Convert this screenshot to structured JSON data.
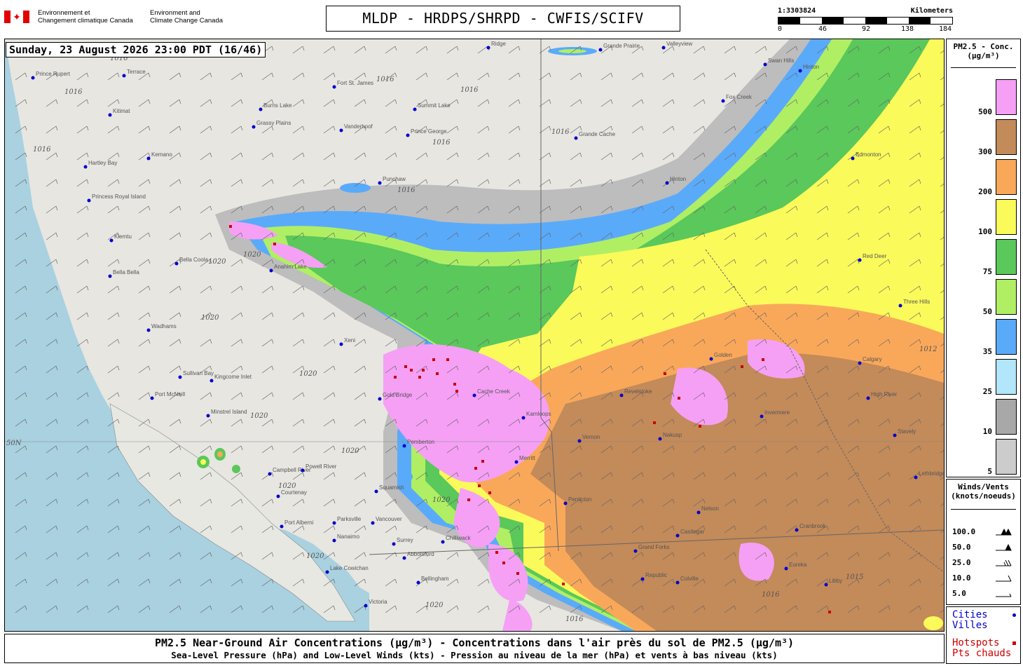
{
  "header": {
    "agency_fr": "Environnement et\nChangement climatique Canada",
    "agency_en": "Environment and\nClimate Change Canada",
    "title": "MLDP - HRDPS/SHRPD - CWFIS/SCIFV"
  },
  "scale": {
    "ratio": "1:3303824",
    "unit": "Kilometers",
    "ticks": [
      "0",
      "46",
      "92",
      "138",
      "184"
    ]
  },
  "map": {
    "timestamp": "Sunday, 23 August 2026 23:00 PDT (16/46)",
    "latitude_label": "50N",
    "cities": [
      {
        "name": "Ridge"
      },
      {
        "name": "Grande Prairie"
      },
      {
        "name": "Valleyview"
      },
      {
        "name": "Swan Hills"
      },
      {
        "name": "Prince Rupert"
      },
      {
        "name": "Terrace"
      },
      {
        "name": "Fort St. James"
      },
      {
        "name": "Burns Lake"
      },
      {
        "name": "Summit Lake"
      },
      {
        "name": "Fox Creek"
      },
      {
        "name": "Hinton"
      },
      {
        "name": "Grassy Plains"
      },
      {
        "name": "Vanderhoof"
      },
      {
        "name": "Prince George"
      },
      {
        "name": "Grande Cache"
      },
      {
        "name": "Edmonton"
      },
      {
        "name": "Kitimat"
      },
      {
        "name": "Hartley Bay"
      },
      {
        "name": "Kemano"
      },
      {
        "name": "Punchaw"
      },
      {
        "name": "Hinton"
      },
      {
        "name": "Princess Royal Island"
      },
      {
        "name": "Klemtu"
      },
      {
        "name": "Bella Bella"
      },
      {
        "name": "Bella Coola"
      },
      {
        "name": "Anahim Lake"
      },
      {
        "name": "Red Deer"
      },
      {
        "name": "Wadhams"
      },
      {
        "name": "Xeni"
      },
      {
        "name": "Three Hills"
      },
      {
        "name": "Sullivan Bay"
      },
      {
        "name": "Kingcome Inlet"
      },
      {
        "name": "Cache Creek"
      },
      {
        "name": "Golden"
      },
      {
        "name": "Calgary"
      },
      {
        "name": "Port McNeill"
      },
      {
        "name": "Gold Bridge"
      },
      {
        "name": "Revelstoke"
      },
      {
        "name": "High River"
      },
      {
        "name": "Minstrel Island"
      },
      {
        "name": "Kamloops"
      },
      {
        "name": "Nakusp"
      },
      {
        "name": "Stavely"
      },
      {
        "name": "Pemberton"
      },
      {
        "name": "Merritt"
      },
      {
        "name": "Vernon"
      },
      {
        "name": "Invermere"
      },
      {
        "name": "Campbell River"
      },
      {
        "name": "Powell River"
      },
      {
        "name": "Courtenay"
      },
      {
        "name": "Squamish"
      },
      {
        "name": "Penticton"
      },
      {
        "name": "Nelson"
      },
      {
        "name": "Port Alberni"
      },
      {
        "name": "Parksville"
      },
      {
        "name": "Vancouver"
      },
      {
        "name": "Nanaimo"
      },
      {
        "name": "Surrey"
      },
      {
        "name": "Chilliwack"
      },
      {
        "name": "Castlegar"
      },
      {
        "name": "Cranbrook"
      },
      {
        "name": "Lethbridge"
      },
      {
        "name": "Abbotsford"
      },
      {
        "name": "Grand Forks"
      },
      {
        "name": "Lake Cowichan"
      },
      {
        "name": "Bellingham"
      },
      {
        "name": "Victoria"
      },
      {
        "name": "Eureka"
      },
      {
        "name": "Libby"
      },
      {
        "name": "Colville"
      },
      {
        "name": "Republic"
      }
    ],
    "isobars": [
      "1016",
      "1016",
      "1016",
      "1016",
      "1016",
      "1016",
      "1016",
      "1016",
      "1016",
      "1016",
      "1020",
      "1020",
      "1020",
      "1020",
      "1020",
      "1020",
      "1020",
      "1020",
      "1020",
      "1020",
      "1012",
      "1015"
    ]
  },
  "legend_conc": {
    "title": "PM2.5 - Conc.\n(µg/m³)",
    "bins": [
      {
        "label": "500",
        "color": "#f5a0f5"
      },
      {
        "label": "300",
        "color": "#c38a5a"
      },
      {
        "label": "200",
        "color": "#f9a85a"
      },
      {
        "label": "100",
        "color": "#fafa5a"
      },
      {
        "label": "75",
        "color": "#5ac85a"
      },
      {
        "label": "50",
        "color": "#b0ef64"
      },
      {
        "label": "35",
        "color": "#5aaafa"
      },
      {
        "label": "25",
        "color": "#b2e6fa"
      },
      {
        "label": "10",
        "color": "#a8a8a8"
      },
      {
        "label": "5",
        "color": "#cccccc"
      }
    ]
  },
  "legend_wind": {
    "title": "Winds/Vents\n(knots/noeuds)",
    "rows": [
      "100.0",
      "50.0",
      "25.0",
      "10.0",
      "5.0"
    ]
  },
  "legend_markers": {
    "cities": "Cities\nVilles",
    "hotspots": "Hotspots\nPts chauds",
    "city_color": "#0000cc",
    "hotspot_color": "#cc0000"
  },
  "caption": {
    "line1": "PM2.5 Near-Ground Air Concentrations (µg/m³) - Concentrations dans l'air près du sol de PM2.5 (µg/m³)",
    "line2": "Sea-Level Pressure (hPa) and Low-Level Winds (kts) - Pression au niveau de la mer (hPa) et vents à bas niveau (kts)"
  }
}
